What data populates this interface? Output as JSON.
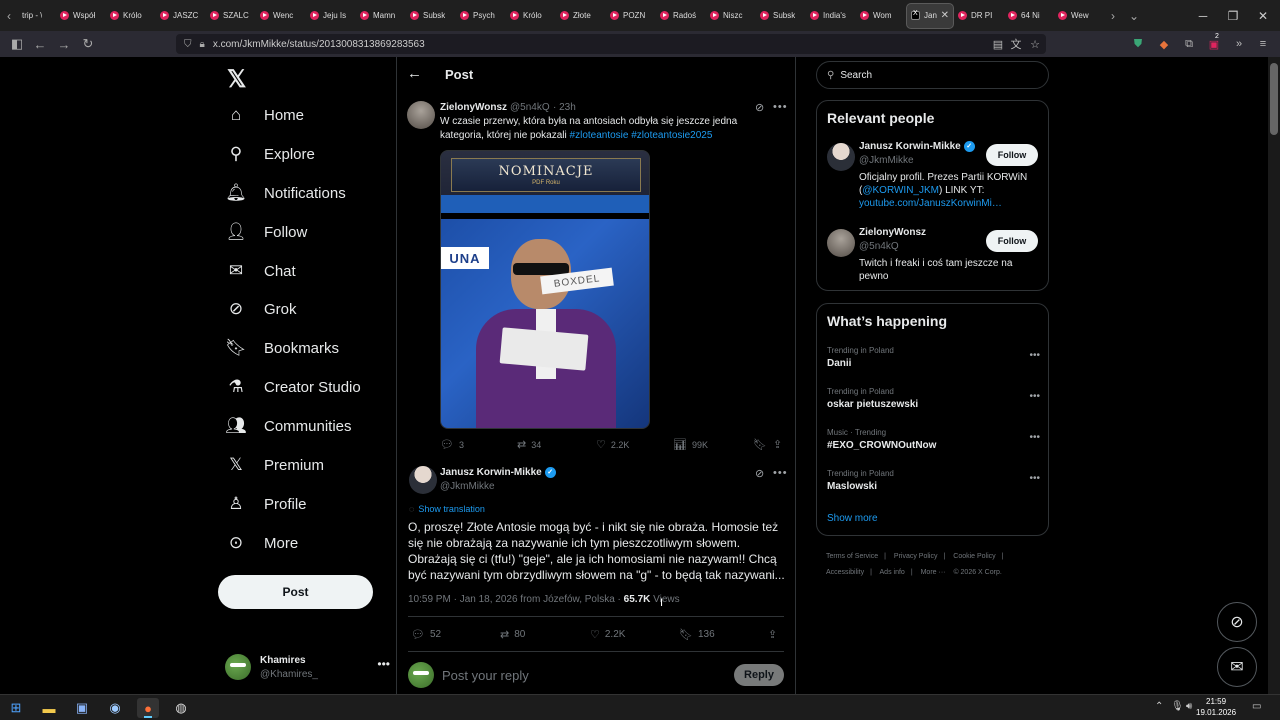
{
  "browser": {
    "tabs": [
      {
        "label": "trip - \\"
      },
      {
        "label": "Współ"
      },
      {
        "label": "Królo"
      },
      {
        "label": "JASZC"
      },
      {
        "label": "SZALC"
      },
      {
        "label": "Wenc"
      },
      {
        "label": "Jeju Is"
      },
      {
        "label": "Mamn"
      },
      {
        "label": "Subsk"
      },
      {
        "label": "Psych"
      },
      {
        "label": "Królo"
      },
      {
        "label": "Złote"
      },
      {
        "label": "POZN"
      },
      {
        "label": "Radoś"
      },
      {
        "label": "Niszc"
      },
      {
        "label": "Subsk"
      },
      {
        "label": "India's"
      },
      {
        "label": "Wom"
      },
      {
        "label": "Jan"
      },
      {
        "label": "DR PI"
      },
      {
        "label": "64 Ni"
      },
      {
        "label": "Wew"
      }
    ],
    "url": "x.com/JkmMikke/status/2013008313869283563",
    "notification_count": "2"
  },
  "nav": {
    "items": [
      {
        "label": "Home",
        "icon": "home-icon"
      },
      {
        "label": "Explore",
        "icon": "search-icon"
      },
      {
        "label": "Notifications",
        "icon": "bell-icon"
      },
      {
        "label": "Follow",
        "icon": "add-person-icon"
      },
      {
        "label": "Chat",
        "icon": "envelope-icon"
      },
      {
        "label": "Grok",
        "icon": "grok-icon"
      },
      {
        "label": "Bookmarks",
        "icon": "bookmark-icon"
      },
      {
        "label": "Creator Studio",
        "icon": "flask-icon"
      },
      {
        "label": "Communities",
        "icon": "people-icon"
      },
      {
        "label": "Premium",
        "icon": "x-icon"
      },
      {
        "label": "Profile",
        "icon": "person-icon"
      },
      {
        "label": "More",
        "icon": "more-circle-icon"
      }
    ],
    "post_label": "Post",
    "account": {
      "name": "Khamires",
      "handle": "@Khamires_"
    }
  },
  "header": {
    "title": "Post"
  },
  "quoted_tweet": {
    "name": "ZielonyWonsz",
    "handle": "@5n4kQ",
    "time": "· 23h",
    "text_line1": "W czasie przerwy, która była na antosiach odbyła się jeszcze jedna",
    "text_line2_plain": "kategoria, której nie pokazali ",
    "hashtag1": "#zloteantosie",
    "hashtag2": "#zloteantosie2025",
    "media": {
      "title": "NOMINACJE",
      "subtitle": "PDF Roku",
      "banner_left": "UNA",
      "card_text": "BOXDEL"
    },
    "stats": {
      "replies": "3",
      "reposts": "34",
      "likes": "2.2K",
      "views": "99K"
    }
  },
  "main_tweet": {
    "name": "Janusz Korwin-Mikke",
    "handle": "@JkmMikke",
    "show_translation": "Show translation",
    "text": "O, proszę! Złote Antosie mogą być - i nikt się nie obraża. Homosie też się nie obrażają za nazywanie ich tym pieszczotliwym słowem. Obrażają się ci (tfu!) \"geje\", ale ja ich homosiami nie nazywam!! Chcą być nazywani tym obrzydliwym słowem na \"g\" - to będą tak nazywani...",
    "meta_time": "10:59 PM · Jan 18, 2026 from Józefów, Polska · ",
    "views_count": "65.7K",
    "views_label": " Views",
    "stats": {
      "replies": "52",
      "reposts": "80",
      "likes": "2.2K",
      "bookmarks": "136"
    }
  },
  "reply": {
    "placeholder": "Post your reply",
    "button": "Reply"
  },
  "search": {
    "placeholder": "Search"
  },
  "relevant_people": {
    "title": "Relevant people",
    "people": [
      {
        "name": "Janusz Korwin-Mikke",
        "handle": "@JkmMikke",
        "bio_a": "Oficjalny profil. Prezes Partii KORWiN (",
        "bio_link1": "@KORWIN_JKM",
        "bio_b": ") LINK YT:",
        "bio_link2": "youtube.com/JanuszKorwinMi…",
        "follow": "Follow"
      },
      {
        "name": "ZielonyWonsz",
        "handle": "@5n4kQ",
        "bio": "Twitch i freaki i coś tam jeszcze na pewno",
        "follow": "Follow"
      }
    ]
  },
  "happening": {
    "title": "What’s happening",
    "trends": [
      {
        "context": "Trending in Poland",
        "name": "Danii"
      },
      {
        "context": "Trending in Poland",
        "name": "oskar pietuszewski"
      },
      {
        "context": "Music · Trending",
        "name": "#EXO_CROWNOutNow"
      },
      {
        "context": "Trending in Poland",
        "name": "Maslowski"
      }
    ],
    "show_more": "Show more"
  },
  "footer": {
    "links": [
      "Terms of Service",
      "Privacy Policy",
      "Cookie Policy",
      "Accessibility",
      "Ads info",
      "More ···",
      "© 2026 X Corp."
    ]
  },
  "taskbar": {
    "time": "21:59",
    "date": "19.01.2026"
  },
  "colors": {
    "accent": "#1d9bf0",
    "border": "#2f3336",
    "muted": "#71767b",
    "text": "#e7e9ea"
  }
}
